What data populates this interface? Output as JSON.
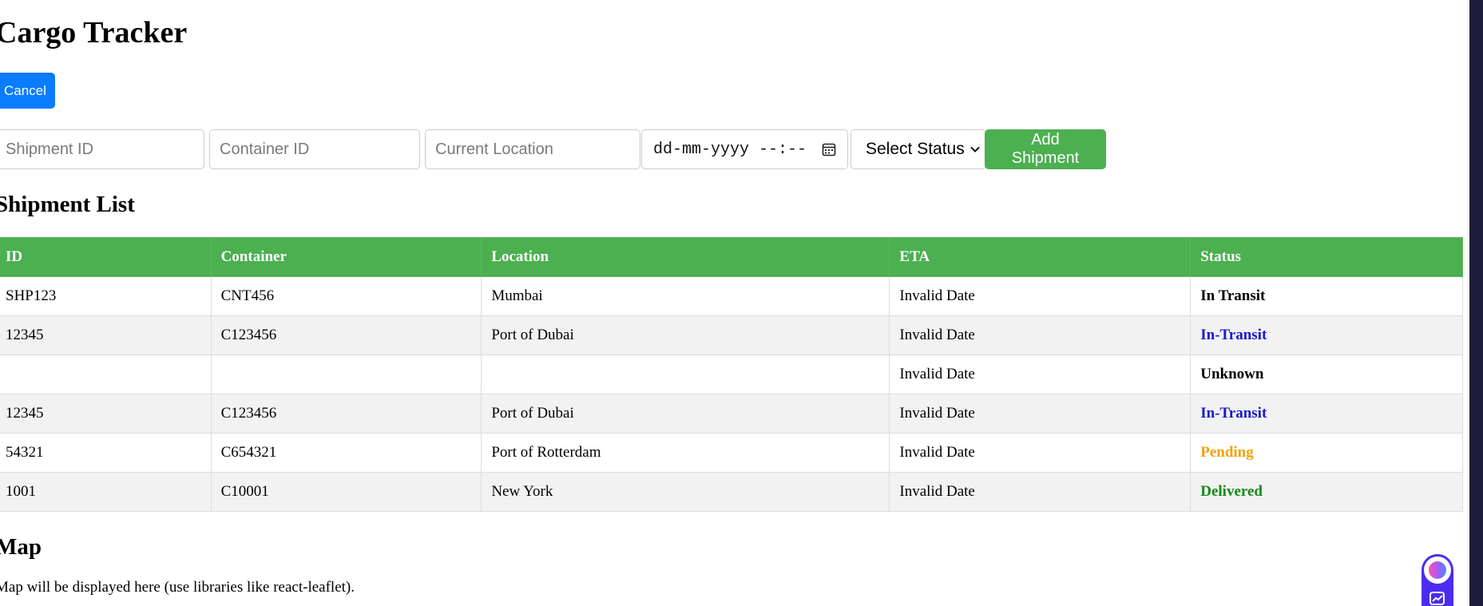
{
  "app": {
    "title": "Cargo Tracker"
  },
  "actions": {
    "cancel_label": "Cancel",
    "add_label": "Add Shipment"
  },
  "form": {
    "shipment_id_placeholder": "Shipment ID",
    "container_id_placeholder": "Container ID",
    "location_placeholder": "Current Location",
    "date_placeholder": "dd-mm-yyyy --:--",
    "status_selected": "Select Status"
  },
  "shipments": {
    "heading": "Shipment List",
    "columns": [
      "ID",
      "Container",
      "Location",
      "ETA",
      "Status"
    ],
    "rows": [
      {
        "id": "SHP123",
        "container": "CNT456",
        "location": "Mumbai",
        "eta": "Invalid Date",
        "status": "In Transit"
      },
      {
        "id": "12345",
        "container": "C123456",
        "location": "Port of Dubai",
        "eta": "Invalid Date",
        "status": "In-Transit"
      },
      {
        "id": "",
        "container": "",
        "location": "",
        "eta": "Invalid Date",
        "status": "Unknown"
      },
      {
        "id": "12345",
        "container": "C123456",
        "location": "Port of Dubai",
        "eta": "Invalid Date",
        "status": "In-Transit"
      },
      {
        "id": "54321",
        "container": "C654321",
        "location": "Port of Rotterdam",
        "eta": "Invalid Date",
        "status": "Pending"
      },
      {
        "id": "1001",
        "container": "C10001",
        "location": "New York",
        "eta": "Invalid Date",
        "status": "Delivered"
      }
    ]
  },
  "map": {
    "heading": "Map",
    "description": "Map will be displayed here (use libraries like react-leaflet)."
  },
  "colors": {
    "primary_button": "#0a7cff",
    "accent_green": "#4caf50",
    "status_in_transit_hyphen": "#1a1acc",
    "status_pending": "#f2a20c",
    "status_delivered": "#138a13"
  },
  "icons": [
    "calendar-icon",
    "chevron-down-icon",
    "extension-logo-icon",
    "extension-chart-icon"
  ]
}
